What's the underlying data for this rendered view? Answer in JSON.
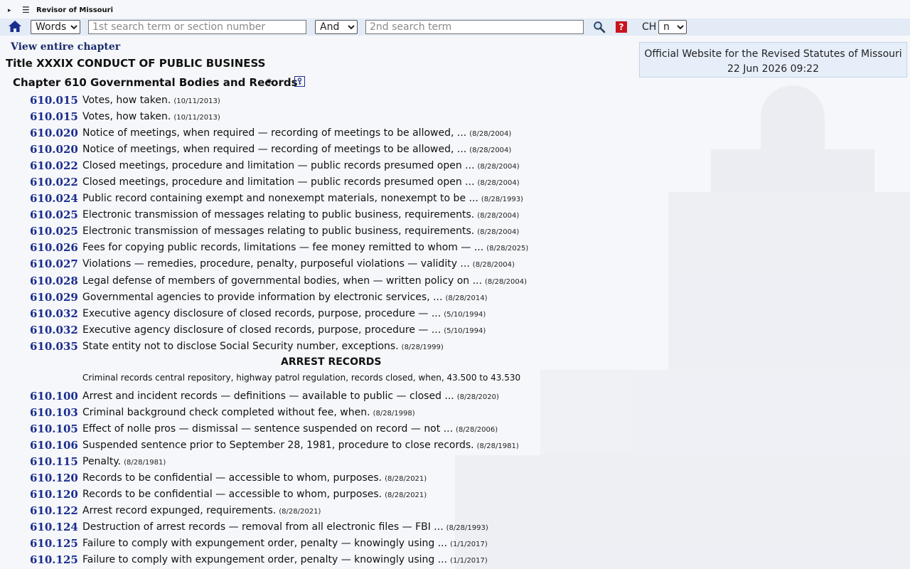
{
  "topbar": {
    "brand": "Revisor of Missouri",
    "menu_glyph": "☰",
    "expand_glyph": "▸"
  },
  "search": {
    "mode_options": [
      "Words"
    ],
    "mode_selected": "Words",
    "term1_placeholder": "1st search term or section number",
    "operator_selected": "And",
    "term2_placeholder": "2nd search term",
    "help_label": "?",
    "ch_label": "CH",
    "ch_selected": "n"
  },
  "view_chapter": "View entire chapter",
  "title": "Title XXXIX CONDUCT OF PUBLIC BUSINESS",
  "chapter": "Chapter 610 Governmental Bodies and Records",
  "star_glyph": "✷",
  "info": {
    "line1": "Official Website for the Revised Statutes of Missouri",
    "line2": "22 Jun 2026 09:22"
  },
  "sections": [
    {
      "num": "610.015",
      "desc": "Votes, how taken.",
      "date": "(10/11/2013)"
    },
    {
      "num": "610.015",
      "desc": "Votes, how taken.",
      "date": "(10/11/2013)"
    },
    {
      "num": "610.020",
      "desc": "Notice of meetings, when required — recording of meetings to be allowed, ...",
      "date": "(8/28/2004)"
    },
    {
      "num": "610.020",
      "desc": "Notice of meetings, when required — recording of meetings to be allowed, ...",
      "date": "(8/28/2004)"
    },
    {
      "num": "610.022",
      "desc": "Closed meetings, procedure and limitation — public records presumed open ...",
      "date": "(8/28/2004)"
    },
    {
      "num": "610.022",
      "desc": "Closed meetings, procedure and limitation — public records presumed open ...",
      "date": "(8/28/2004)"
    },
    {
      "num": "610.024",
      "desc": "Public record containing exempt and nonexempt materials, nonexempt to be ...",
      "date": "(8/28/1993)"
    },
    {
      "num": "610.025",
      "desc": "Electronic transmission of messages relating to public business, requirements.",
      "date": "(8/28/2004)"
    },
    {
      "num": "610.025",
      "desc": "Electronic transmission of messages relating to public business, requirements.",
      "date": "(8/28/2004)"
    },
    {
      "num": "610.026",
      "desc": "Fees for copying public records, limitations — fee money remitted to whom — ...",
      "date": "(8/28/2025)"
    },
    {
      "num": "610.027",
      "desc": "Violations — remedies, procedure, penalty, purposeful violations — validity ...",
      "date": "(8/28/2004)"
    },
    {
      "num": "610.028",
      "desc": "Legal defense of members of governmental bodies, when — written policy on ...",
      "date": "(8/28/2004)"
    },
    {
      "num": "610.029",
      "desc": "Governmental agencies to provide information by electronic services, ...",
      "date": "(8/28/2014)"
    },
    {
      "num": "610.032",
      "desc": "Executive agency disclosure of closed records, purpose, procedure — ...",
      "date": "(5/10/1994)"
    },
    {
      "num": "610.032",
      "desc": "Executive agency disclosure of closed records, purpose, procedure — ...",
      "date": "(5/10/1994)"
    },
    {
      "num": "610.035",
      "desc": "State entity not to disclose Social Security number, exceptions.",
      "date": "(8/28/1999)"
    }
  ],
  "arrest": {
    "heading": "ARREST RECORDS",
    "subtitle": "Criminal records central repository, highway patrol regulation, records closed, when, 43.500 to 43.530"
  },
  "arrest_sections": [
    {
      "num": "610.100",
      "desc": "Arrest and incident records — definitions — available to public — closed ...",
      "date": "(8/28/2020)"
    },
    {
      "num": "610.103",
      "desc": "Criminal background check completed without fee, when.",
      "date": "(8/28/1998)"
    },
    {
      "num": "610.105",
      "desc": "Effect of nolle pros — dismissal — sentence suspended on record — not ...",
      "date": "(8/28/2006)"
    },
    {
      "num": "610.106",
      "desc": "Suspended sentence prior to September 28, 1981, procedure to close records.",
      "date": "(8/28/1981)"
    },
    {
      "num": "610.115",
      "desc": "Penalty.",
      "date": "(8/28/1981)"
    },
    {
      "num": "610.120",
      "desc": "Records to be confidential — accessible to whom, purposes.",
      "date": "(8/28/2021)"
    },
    {
      "num": "610.120",
      "desc": "Records to be confidential — accessible to whom, purposes.",
      "date": "(8/28/2021)"
    },
    {
      "num": "610.122",
      "desc": "Arrest record expunged, requirements.",
      "date": "(8/28/2021)"
    },
    {
      "num": "610.124",
      "desc": "Destruction of arrest records — removal from all electronic files — FBI ...",
      "date": "(8/28/1993)"
    },
    {
      "num": "610.125",
      "desc": "Failure to comply with expungement order, penalty — knowingly using ...",
      "date": "(1/1/2017)"
    },
    {
      "num": "610.125",
      "desc": "Failure to comply with expungement order, penalty — knowingly using ...",
      "date": "(1/1/2017)"
    }
  ]
}
